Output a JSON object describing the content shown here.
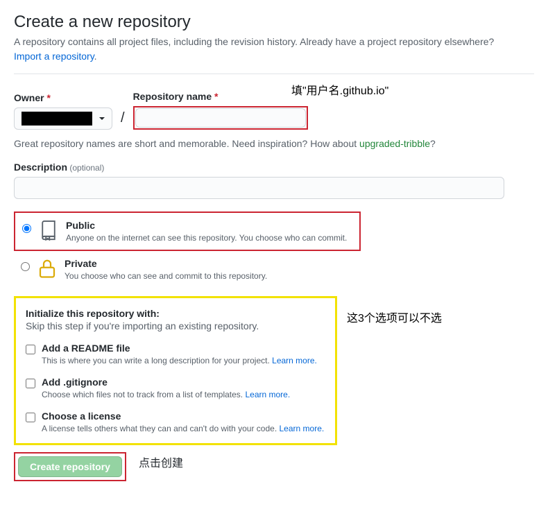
{
  "header": {
    "title": "Create a new repository",
    "subhead": "A repository contains all project files, including the revision history. Already have a project repository elsewhere?",
    "import_link": "Import a repository"
  },
  "annotations": {
    "repo_name": "填\"用户名.github.io\"",
    "init": "这3个选项可以不选",
    "create": "点击创建"
  },
  "owner": {
    "label": "Owner"
  },
  "repo": {
    "label": "Repository name",
    "value": ""
  },
  "hint": {
    "prefix": "Great repository names are short and memorable. Need inspiration? How about ",
    "suggestion": "upgraded-tribble",
    "suffix": "?"
  },
  "description": {
    "label": "Description",
    "optional": " (optional)",
    "value": ""
  },
  "visibility": {
    "public": {
      "label": "Public",
      "sub": "Anyone on the internet can see this repository. You choose who can commit."
    },
    "private": {
      "label": "Private",
      "sub": "You choose who can see and commit to this repository."
    }
  },
  "init": {
    "title": "Initialize this repository with:",
    "sub": "Skip this step if you're importing an existing repository.",
    "readme": {
      "label": "Add a README file",
      "sub_prefix": "This is where you can write a long description for your project. ",
      "learn": "Learn more."
    },
    "gitignore": {
      "label": "Add .gitignore",
      "sub_prefix": "Choose which files not to track from a list of templates. ",
      "learn": "Learn more."
    },
    "license": {
      "label": "Choose a license",
      "sub_prefix": "A license tells others what they can and can't do with your code. ",
      "learn": "Learn more."
    }
  },
  "create_button": "Create repository"
}
